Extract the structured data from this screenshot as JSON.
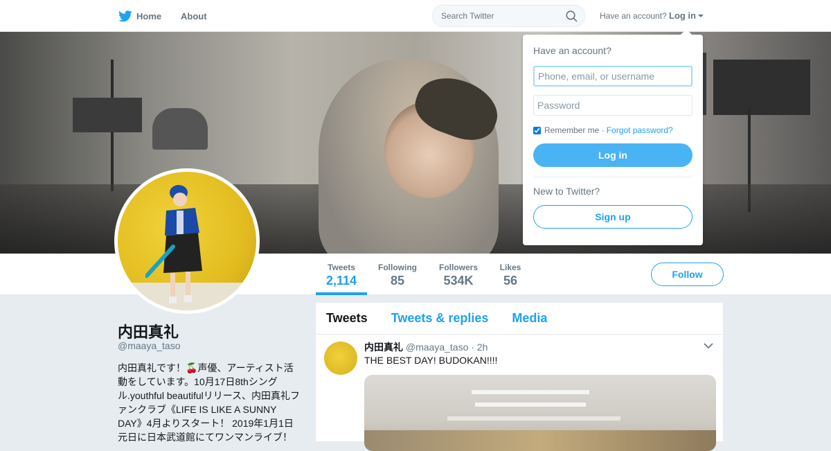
{
  "nav": {
    "home_label": "Home",
    "about_label": "About",
    "search_placeholder": "Search Twitter",
    "have_account_label": "Have an account?",
    "login_label": "Log in"
  },
  "profile": {
    "name": "内田真礼",
    "handle": "@maaya_taso",
    "bio": "内田真礼です！🍒声優、アーティスト活動をしています。10月17日8thシングル.youthful beautifulリリース、内田真礼ファンクラブ《LIFE IS LIKE A SUNNY DAY》4月よりスタート！ 2019年1月1日元日に日本武道館にてワンマンライブ！",
    "follow_label": "Follow"
  },
  "stats": [
    {
      "label": "Tweets",
      "value": "2,114"
    },
    {
      "label": "Following",
      "value": "85"
    },
    {
      "label": "Followers",
      "value": "534K"
    },
    {
      "label": "Likes",
      "value": "56"
    }
  ],
  "timeline": {
    "tabs": [
      "Tweets",
      "Tweets & replies",
      "Media"
    ],
    "tweet": {
      "name": "内田真礼",
      "meta": "@maaya_taso · 2h",
      "text": "THE BEST DAY!  BUDOKAN!!!!"
    }
  },
  "login_dropdown": {
    "title": "Have an account?",
    "username_placeholder": "Phone, email, or username",
    "password_placeholder": "Password",
    "remember_label": "Remember me ·",
    "forgot_label": "Forgot password?",
    "login_button": "Log in",
    "new_label": "New to Twitter?",
    "signup_button": "Sign up"
  },
  "colors": {
    "accent": "#1da1f2",
    "login_button": "#4ab3f4",
    "background": "#e6ecf0"
  }
}
